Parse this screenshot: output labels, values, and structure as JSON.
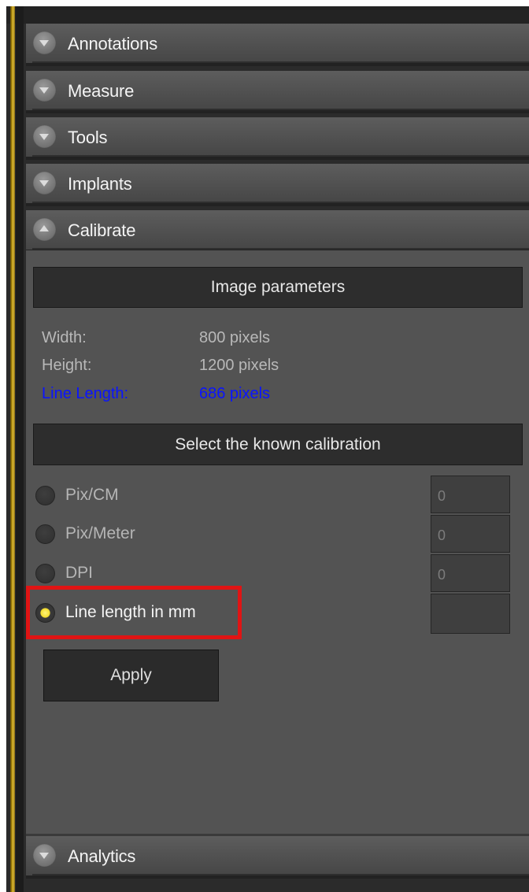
{
  "sections": [
    {
      "label": "Annotations",
      "state": "collapsed",
      "icon": "chevron-down-icon"
    },
    {
      "label": "Measure",
      "state": "collapsed",
      "icon": "chevron-down-icon"
    },
    {
      "label": "Tools",
      "state": "collapsed",
      "icon": "chevron-down-icon"
    },
    {
      "label": "Implants",
      "state": "collapsed",
      "icon": "chevron-down-icon"
    },
    {
      "label": "Calibrate",
      "state": "expanded",
      "icon": "chevron-up-icon"
    },
    {
      "label": "Analytics",
      "state": "collapsed",
      "icon": "chevron-down-icon"
    }
  ],
  "calibrate": {
    "image_parameters_header": "Image parameters",
    "params": [
      {
        "label": "Width:",
        "value": "800 pixels"
      },
      {
        "label": "Height:",
        "value": "1200 pixels"
      },
      {
        "label": "Line Length:",
        "value": "686 pixels"
      }
    ],
    "select_header": "Select the known calibration",
    "options": [
      {
        "label": "Pix/CM",
        "selected": false,
        "value": "0"
      },
      {
        "label": "Pix/Meter",
        "selected": false,
        "value": "0"
      },
      {
        "label": "DPI",
        "selected": false,
        "value": "0"
      },
      {
        "label": "Line length in mm",
        "selected": true,
        "value": ""
      }
    ],
    "apply_label": "Apply"
  },
  "colors": {
    "accent_gold": "#d4af37",
    "selected_radio": "#f2dc2e",
    "highlight_box": "#e01414",
    "line_length_text": "#0a14ff"
  }
}
